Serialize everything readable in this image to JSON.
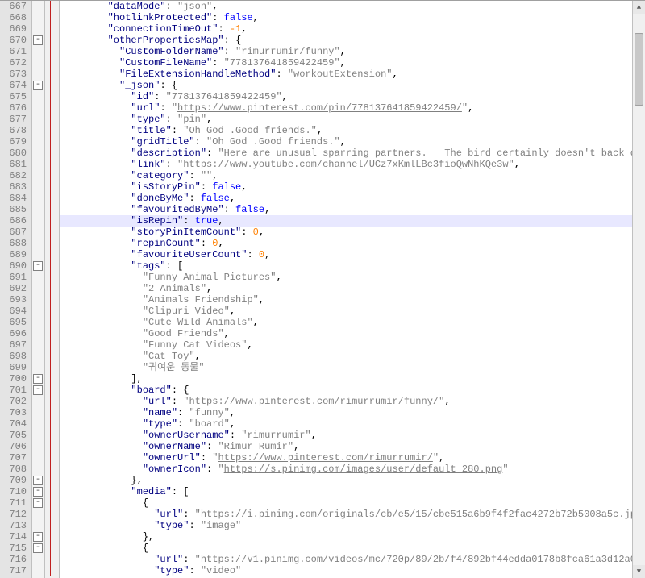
{
  "editor": {
    "first_line": 667,
    "highlight_line": 686,
    "fold_markers": [
      670,
      674,
      690,
      700,
      701,
      709,
      710,
      711,
      714,
      715
    ],
    "margin_bar": {
      "from": 667,
      "to": 717
    }
  },
  "code_tokens": [
    {
      "ln": 667,
      "indent": 8,
      "t": [
        [
          "k",
          "\"dataMode\""
        ],
        [
          "p",
          ": "
        ],
        [
          "s",
          "\"json\""
        ],
        [
          "p",
          ","
        ]
      ]
    },
    {
      "ln": 668,
      "indent": 8,
      "t": [
        [
          "k",
          "\"hotlinkProtected\""
        ],
        [
          "p",
          ": "
        ],
        [
          "b",
          "false"
        ],
        [
          "p",
          ","
        ]
      ]
    },
    {
      "ln": 669,
      "indent": 8,
      "t": [
        [
          "k",
          "\"connectionTimeOut\""
        ],
        [
          "p",
          ": "
        ],
        [
          "n",
          "-1"
        ],
        [
          "p",
          ","
        ]
      ]
    },
    {
      "ln": 670,
      "indent": 8,
      "t": [
        [
          "k",
          "\"otherPropertiesMap\""
        ],
        [
          "p",
          ": {"
        ]
      ]
    },
    {
      "ln": 671,
      "indent": 10,
      "t": [
        [
          "k",
          "\"CustomFolderName\""
        ],
        [
          "p",
          ": "
        ],
        [
          "s",
          "\"rimurrumir/funny\""
        ],
        [
          "p",
          ","
        ]
      ]
    },
    {
      "ln": 672,
      "indent": 10,
      "t": [
        [
          "k",
          "\"CustomFileName\""
        ],
        [
          "p",
          ": "
        ],
        [
          "s",
          "\"778137641859422459\""
        ],
        [
          "p",
          ","
        ]
      ]
    },
    {
      "ln": 673,
      "indent": 10,
      "t": [
        [
          "k",
          "\"FileExtensionHandleMethod\""
        ],
        [
          "p",
          ": "
        ],
        [
          "s",
          "\"workoutExtension\""
        ],
        [
          "p",
          ","
        ]
      ]
    },
    {
      "ln": 674,
      "indent": 10,
      "t": [
        [
          "k",
          "\"_json\""
        ],
        [
          "p",
          ": {"
        ]
      ]
    },
    {
      "ln": 675,
      "indent": 12,
      "t": [
        [
          "k",
          "\"id\""
        ],
        [
          "p",
          ": "
        ],
        [
          "s",
          "\"778137641859422459\""
        ],
        [
          "p",
          ","
        ]
      ]
    },
    {
      "ln": 676,
      "indent": 12,
      "t": [
        [
          "k",
          "\"url\""
        ],
        [
          "p",
          ": "
        ],
        [
          "s",
          "\""
        ],
        [
          "su",
          "https://www.pinterest.com/pin/778137641859422459/"
        ],
        [
          "s",
          "\""
        ],
        [
          "p",
          ","
        ]
      ]
    },
    {
      "ln": 677,
      "indent": 12,
      "t": [
        [
          "k",
          "\"type\""
        ],
        [
          "p",
          ": "
        ],
        [
          "s",
          "\"pin\""
        ],
        [
          "p",
          ","
        ]
      ]
    },
    {
      "ln": 678,
      "indent": 12,
      "t": [
        [
          "k",
          "\"title\""
        ],
        [
          "p",
          ": "
        ],
        [
          "s",
          "\"Oh God .Good friends.\""
        ],
        [
          "p",
          ","
        ]
      ]
    },
    {
      "ln": 679,
      "indent": 12,
      "t": [
        [
          "k",
          "\"gridTitle\""
        ],
        [
          "p",
          ": "
        ],
        [
          "s",
          "\"Oh God .Good friends.\""
        ],
        [
          "p",
          ","
        ]
      ]
    },
    {
      "ln": 680,
      "indent": 12,
      "t": [
        [
          "k",
          "\"description\""
        ],
        [
          "p",
          ": "
        ],
        [
          "s",
          "\"Here are unusual sparring partners.   The bird certainly doesn't back down.\""
        ],
        [
          "p",
          ","
        ]
      ]
    },
    {
      "ln": 681,
      "indent": 12,
      "t": [
        [
          "k",
          "\"link\""
        ],
        [
          "p",
          ": "
        ],
        [
          "s",
          "\""
        ],
        [
          "su",
          "https://www.youtube.com/channel/UCz7xKmlLBc3fioQwNhKQe3w"
        ],
        [
          "s",
          "\""
        ],
        [
          "p",
          ","
        ]
      ]
    },
    {
      "ln": 682,
      "indent": 12,
      "t": [
        [
          "k",
          "\"category\""
        ],
        [
          "p",
          ": "
        ],
        [
          "s",
          "\"\""
        ],
        [
          "p",
          ","
        ]
      ]
    },
    {
      "ln": 683,
      "indent": 12,
      "t": [
        [
          "k",
          "\"isStoryPin\""
        ],
        [
          "p",
          ": "
        ],
        [
          "b",
          "false"
        ],
        [
          "p",
          ","
        ]
      ]
    },
    {
      "ln": 684,
      "indent": 12,
      "t": [
        [
          "k",
          "\"doneByMe\""
        ],
        [
          "p",
          ": "
        ],
        [
          "b",
          "false"
        ],
        [
          "p",
          ","
        ]
      ]
    },
    {
      "ln": 685,
      "indent": 12,
      "t": [
        [
          "k",
          "\"favouritedByMe\""
        ],
        [
          "p",
          ": "
        ],
        [
          "b",
          "false"
        ],
        [
          "p",
          ","
        ]
      ]
    },
    {
      "ln": 686,
      "indent": 12,
      "t": [
        [
          "k",
          "\"isRepin\""
        ],
        [
          "p",
          ": "
        ],
        [
          "b",
          "true"
        ],
        [
          "p",
          ","
        ]
      ]
    },
    {
      "ln": 687,
      "indent": 12,
      "t": [
        [
          "k",
          "\"storyPinItemCount\""
        ],
        [
          "p",
          ": "
        ],
        [
          "n",
          "0"
        ],
        [
          "p",
          ","
        ]
      ]
    },
    {
      "ln": 688,
      "indent": 12,
      "t": [
        [
          "k",
          "\"repinCount\""
        ],
        [
          "p",
          ": "
        ],
        [
          "n",
          "0"
        ],
        [
          "p",
          ","
        ]
      ]
    },
    {
      "ln": 689,
      "indent": 12,
      "t": [
        [
          "k",
          "\"favouriteUserCount\""
        ],
        [
          "p",
          ": "
        ],
        [
          "n",
          "0"
        ],
        [
          "p",
          ","
        ]
      ]
    },
    {
      "ln": 690,
      "indent": 12,
      "t": [
        [
          "k",
          "\"tags\""
        ],
        [
          "p",
          ": ["
        ]
      ]
    },
    {
      "ln": 691,
      "indent": 14,
      "t": [
        [
          "s",
          "\"Funny Animal Pictures\""
        ],
        [
          "p",
          ","
        ]
      ]
    },
    {
      "ln": 692,
      "indent": 14,
      "t": [
        [
          "s",
          "\"2 Animals\""
        ],
        [
          "p",
          ","
        ]
      ]
    },
    {
      "ln": 693,
      "indent": 14,
      "t": [
        [
          "s",
          "\"Animals Friendship\""
        ],
        [
          "p",
          ","
        ]
      ]
    },
    {
      "ln": 694,
      "indent": 14,
      "t": [
        [
          "s",
          "\"Clipuri Video\""
        ],
        [
          "p",
          ","
        ]
      ]
    },
    {
      "ln": 695,
      "indent": 14,
      "t": [
        [
          "s",
          "\"Cute Wild Animals\""
        ],
        [
          "p",
          ","
        ]
      ]
    },
    {
      "ln": 696,
      "indent": 14,
      "t": [
        [
          "s",
          "\"Good Friends\""
        ],
        [
          "p",
          ","
        ]
      ]
    },
    {
      "ln": 697,
      "indent": 14,
      "t": [
        [
          "s",
          "\"Funny Cat Videos\""
        ],
        [
          "p",
          ","
        ]
      ]
    },
    {
      "ln": 698,
      "indent": 14,
      "t": [
        [
          "s",
          "\"Cat Toy\""
        ],
        [
          "p",
          ","
        ]
      ]
    },
    {
      "ln": 699,
      "indent": 14,
      "t": [
        [
          "s",
          "\"귀여운 동물\""
        ]
      ]
    },
    {
      "ln": 700,
      "indent": 12,
      "t": [
        [
          "p",
          "],"
        ]
      ]
    },
    {
      "ln": 701,
      "indent": 12,
      "t": [
        [
          "k",
          "\"board\""
        ],
        [
          "p",
          ": {"
        ]
      ]
    },
    {
      "ln": 702,
      "indent": 14,
      "t": [
        [
          "k",
          "\"url\""
        ],
        [
          "p",
          ": "
        ],
        [
          "s",
          "\""
        ],
        [
          "su",
          "https://www.pinterest.com/rimurrumir/funny/"
        ],
        [
          "s",
          "\""
        ],
        [
          "p",
          ","
        ]
      ]
    },
    {
      "ln": 703,
      "indent": 14,
      "t": [
        [
          "k",
          "\"name\""
        ],
        [
          "p",
          ": "
        ],
        [
          "s",
          "\"funny\""
        ],
        [
          "p",
          ","
        ]
      ]
    },
    {
      "ln": 704,
      "indent": 14,
      "t": [
        [
          "k",
          "\"type\""
        ],
        [
          "p",
          ": "
        ],
        [
          "s",
          "\"board\""
        ],
        [
          "p",
          ","
        ]
      ]
    },
    {
      "ln": 705,
      "indent": 14,
      "t": [
        [
          "k",
          "\"ownerUsername\""
        ],
        [
          "p",
          ": "
        ],
        [
          "s",
          "\"rimurrumir\""
        ],
        [
          "p",
          ","
        ]
      ]
    },
    {
      "ln": 706,
      "indent": 14,
      "t": [
        [
          "k",
          "\"ownerName\""
        ],
        [
          "p",
          ": "
        ],
        [
          "s",
          "\"Rimur Rumir\""
        ],
        [
          "p",
          ","
        ]
      ]
    },
    {
      "ln": 707,
      "indent": 14,
      "t": [
        [
          "k",
          "\"ownerUrl\""
        ],
        [
          "p",
          ": "
        ],
        [
          "s",
          "\""
        ],
        [
          "su",
          "https://www.pinterest.com/rimurrumir/"
        ],
        [
          "s",
          "\""
        ],
        [
          "p",
          ","
        ]
      ]
    },
    {
      "ln": 708,
      "indent": 14,
      "t": [
        [
          "k",
          "\"ownerIcon\""
        ],
        [
          "p",
          ": "
        ],
        [
          "s",
          "\""
        ],
        [
          "su",
          "https://s.pinimg.com/images/user/default_280.png"
        ],
        [
          "s",
          "\""
        ]
      ]
    },
    {
      "ln": 709,
      "indent": 12,
      "t": [
        [
          "p",
          "},"
        ]
      ]
    },
    {
      "ln": 710,
      "indent": 12,
      "t": [
        [
          "k",
          "\"media\""
        ],
        [
          "p",
          ": ["
        ]
      ]
    },
    {
      "ln": 711,
      "indent": 14,
      "t": [
        [
          "p",
          "{"
        ]
      ]
    },
    {
      "ln": 712,
      "indent": 16,
      "t": [
        [
          "k",
          "\"url\""
        ],
        [
          "p",
          ": "
        ],
        [
          "s",
          "\""
        ],
        [
          "su",
          "https://i.pinimg.com/originals/cb/e5/15/cbe515a6b9f4f2fac4272b72b5008a5c.jpg"
        ],
        [
          "s",
          "\""
        ],
        [
          "p",
          ","
        ]
      ]
    },
    {
      "ln": 713,
      "indent": 16,
      "t": [
        [
          "k",
          "\"type\""
        ],
        [
          "p",
          ": "
        ],
        [
          "s",
          "\"image\""
        ]
      ]
    },
    {
      "ln": 714,
      "indent": 14,
      "t": [
        [
          "p",
          "},"
        ]
      ]
    },
    {
      "ln": 715,
      "indent": 14,
      "t": [
        [
          "p",
          "{"
        ]
      ]
    },
    {
      "ln": 716,
      "indent": 16,
      "t": [
        [
          "k",
          "\"url\""
        ],
        [
          "p",
          ": "
        ],
        [
          "s",
          "\""
        ],
        [
          "su",
          "https://v1.pinimg.com/videos/mc/720p/89/2b/f4/892bf44edda0178b8fca61a3d12a093b.mp4"
        ],
        [
          "s",
          "\""
        ]
      ]
    },
    {
      "ln": 717,
      "indent": 16,
      "t": [
        [
          "k",
          "\"type\""
        ],
        [
          "p",
          ": "
        ],
        [
          "s",
          "\"video\""
        ]
      ]
    }
  ]
}
